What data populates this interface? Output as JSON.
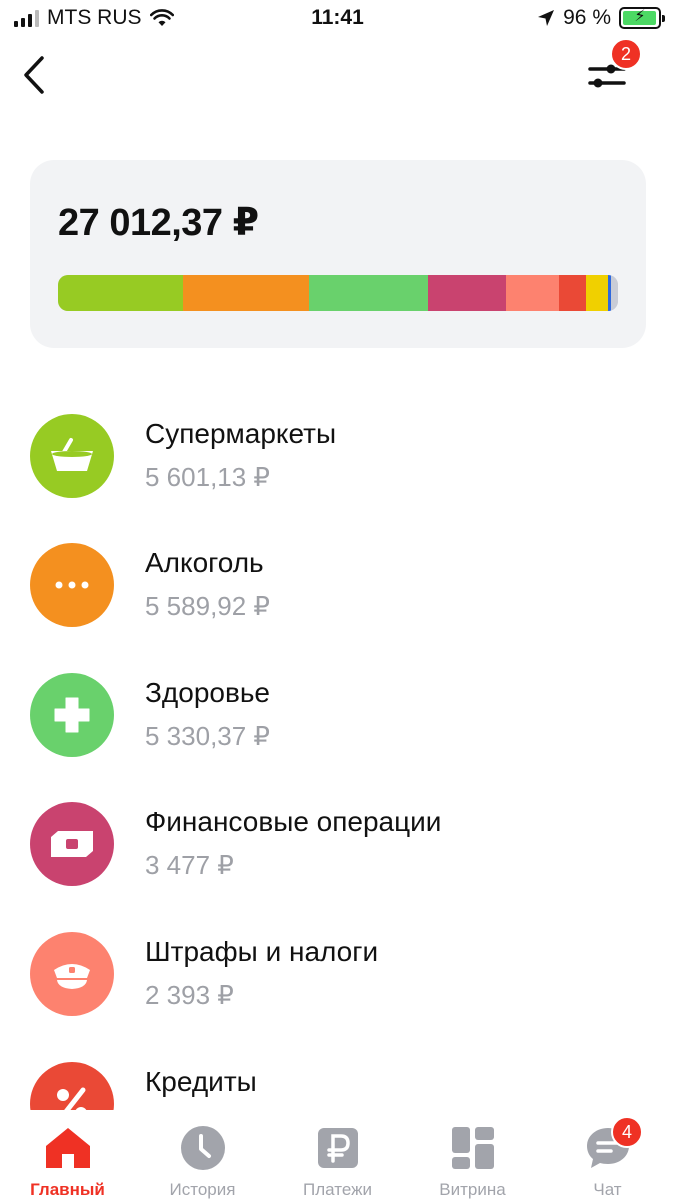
{
  "status_bar": {
    "carrier": "MTS RUS",
    "time": "11:41",
    "battery": "96 %",
    "battery_level": 0.96
  },
  "nav": {
    "back_icon": "chevron-left-icon",
    "filter_icon": "sliders-icon",
    "filter_badge": "2"
  },
  "summary": {
    "total": "27 012,37 ₽",
    "bar_segments": [
      {
        "category": "Супермаркеты",
        "value": 5601.13,
        "color": "#97cb23"
      },
      {
        "category": "Алкоголь",
        "value": 5589.92,
        "color": "#f4901f"
      },
      {
        "category": "Здоровье",
        "value": 5330.37,
        "color": "#69d16c"
      },
      {
        "category": "Финансовые операции",
        "value": 3477,
        "color": "#c9436f"
      },
      {
        "category": "Штрафы и налоги",
        "value": 2393,
        "color": "#fd826f"
      },
      {
        "category": "Кредиты",
        "value": 1200,
        "color": "#ea4936"
      },
      {
        "category": "",
        "value": 970,
        "color": "#f0d000"
      },
      {
        "category": "",
        "value": 160,
        "color": "#2f68dd"
      },
      {
        "category": "",
        "value": 291,
        "color": "#c9ccd6"
      }
    ]
  },
  "categories": [
    {
      "name": "Супермаркеты",
      "amount": "5 601,13 ₽",
      "color": "#97cb23",
      "icon": "basket-icon"
    },
    {
      "name": "Алкоголь",
      "amount": "5 589,92 ₽",
      "color": "#f4901f",
      "icon": "dots-icon"
    },
    {
      "name": "Здоровье",
      "amount": "5 330,37 ₽",
      "color": "#69d16c",
      "icon": "medical-cross-icon"
    },
    {
      "name": "Финансовые операции",
      "amount": "3 477 ₽",
      "color": "#c9436f",
      "icon": "banknote-icon"
    },
    {
      "name": "Штрафы и налоги",
      "amount": "2 393 ₽",
      "color": "#fd826f",
      "icon": "police-cap-icon"
    },
    {
      "name": "Кредиты",
      "amount": "",
      "color": "#ea4936",
      "icon": "percent-icon"
    }
  ],
  "tabbar": {
    "tabs": [
      {
        "label": "Главный",
        "icon": "home-icon",
        "active": true
      },
      {
        "label": "История",
        "icon": "clock-icon",
        "active": false
      },
      {
        "label": "Платежи",
        "icon": "ruble-icon",
        "active": false
      },
      {
        "label": "Витрина",
        "icon": "grid-icon",
        "active": false
      },
      {
        "label": "Чат",
        "icon": "chat-icon",
        "active": false
      }
    ],
    "chat_badge": "4"
  },
  "colors": {
    "accent": "#ef3124",
    "muted_text": "#9ea0a6",
    "card_bg": "#f2f3f5",
    "tab_inactive": "#a2a4ab"
  }
}
